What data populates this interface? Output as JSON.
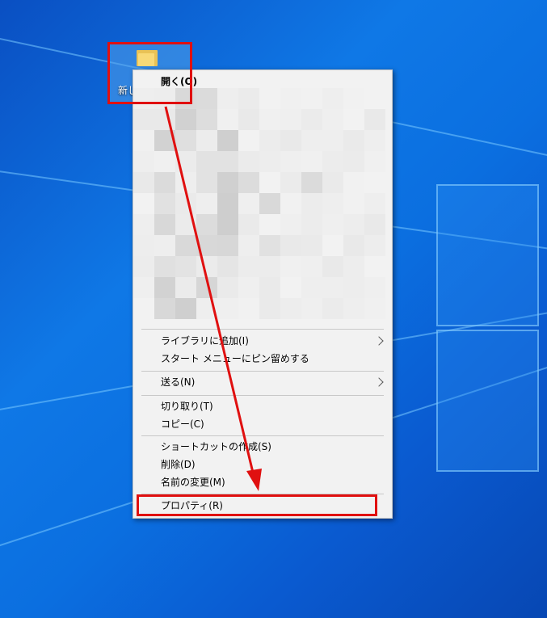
{
  "desktop": {
    "icon": {
      "label": "新し"
    }
  },
  "context_menu": {
    "items": [
      {
        "label": "開く(O)",
        "bold": true
      },
      {
        "label": "ライブラリに追加(I)",
        "submenu": true
      },
      {
        "label": "スタート メニューにピン留めする"
      },
      {
        "label": "送る(N)",
        "submenu": true
      },
      {
        "label": "切り取り(T)"
      },
      {
        "label": "コピー(C)"
      },
      {
        "label": "ショートカットの作成(S)"
      },
      {
        "label": "削除(D)"
      },
      {
        "label": "名前の変更(M)"
      },
      {
        "label": "プロパティ(R)"
      }
    ]
  },
  "colors": {
    "annotation": "#e01010",
    "menu_background": "#f2f2f2"
  },
  "icons": [
    "folder-icon",
    "chevron-right-icon"
  ]
}
